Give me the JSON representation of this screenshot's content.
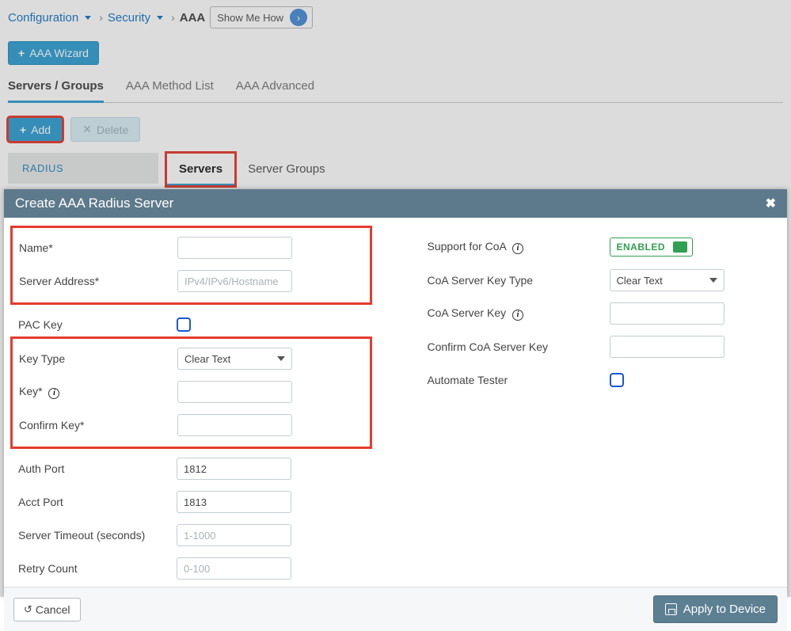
{
  "breadcrumb": {
    "configuration": "Configuration",
    "security": "Security",
    "aaa": "AAA",
    "show_me_how": "Show Me How"
  },
  "aaa_wizard_label": "AAA Wizard",
  "top_tabs": {
    "servers_groups": "Servers / Groups",
    "method_list": "AAA Method List",
    "advanced": "AAA Advanced"
  },
  "toolbar": {
    "add": "Add",
    "delete": "Delete"
  },
  "side": {
    "radius": "RADIUS"
  },
  "sub_tabs": {
    "servers": "Servers",
    "server_groups": "Server Groups"
  },
  "modal": {
    "title": "Create AAA Radius Server",
    "left": {
      "name": "Name*",
      "server_address": "Server Address*",
      "server_address_ph": "IPv4/IPv6/Hostname",
      "pac_key": "PAC Key",
      "key_type": "Key Type",
      "key_type_value": "Clear Text",
      "key": "Key*",
      "confirm_key": "Confirm Key*",
      "auth_port": "Auth Port",
      "auth_port_value": "1812",
      "acct_port": "Acct Port",
      "acct_port_value": "1813",
      "server_timeout": "Server Timeout (seconds)",
      "server_timeout_ph": "1-1000",
      "retry_count": "Retry Count",
      "retry_count_ph": "0-100"
    },
    "right": {
      "support_coa": "Support for CoA",
      "enabled": "ENABLED",
      "coa_key_type": "CoA Server Key Type",
      "coa_key_type_value": "Clear Text",
      "coa_key": "CoA Server Key",
      "confirm_coa_key": "Confirm CoA Server Key",
      "automate_tester": "Automate Tester"
    },
    "footer": {
      "cancel": "Cancel",
      "apply": "Apply to Device"
    }
  }
}
